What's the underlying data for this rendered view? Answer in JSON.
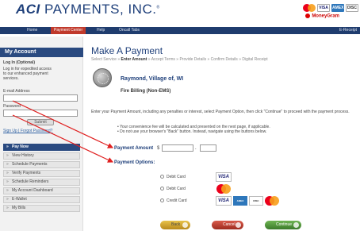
{
  "header": {
    "logo_bold": "ACI",
    "logo_rest": "PAYMENTS, INC.",
    "logo_tm": "®",
    "cards": [
      "VISA",
      "",
      "AMEX",
      "DISC"
    ],
    "moneygram": "MoneyGram"
  },
  "nav": {
    "items": [
      "Home",
      "Payment Center",
      "Help",
      "Oncall Tabs",
      "E-Receipt"
    ]
  },
  "sidebar": {
    "title": "My Account",
    "login_title": "Log In (Optional)",
    "login_text_1": "Log in for expedited access",
    "login_text_2": "to our enhanced payment",
    "login_text_3": "services.",
    "email_label": "E-mail Address",
    "password_label": "Password",
    "submit_label": "Submit",
    "links": "Sign Up | Forgot Password?",
    "menu_head": "Pay Now",
    "menu_items": [
      "View History",
      "Schedule Payments",
      "Verify Payments",
      "Schedule Reminders",
      "My Account Dashboard",
      "E-Wallet",
      "My Bills"
    ]
  },
  "main": {
    "title": "Make A Payment",
    "breadcrumb_prefix": "Select Service »",
    "breadcrumb_current": "Enter Amount",
    "breadcrumb_rest": "» Accept Terms » Provide Details » Confirm Details » Digital Receipt",
    "org_name": "Raymond, Village of, WI",
    "sub_name": "Fire Billing (Non-EMS)",
    "instructions": "Enter your Payment Amount, including any penalties or interest, select Payment Option, then click \"Continue\" to proceed with the payment process.",
    "bullet_1": "• Your convenience fee will be calculated and presented on the next page, if applicable.",
    "bullet_2": "• Do not use your browser's \"Back\" button. Instead, navigate using the buttons below.",
    "amount_label": "Payment Amount",
    "dollar": "$",
    "dot": ".",
    "options_label": "Payment Options:",
    "options": [
      "Debit Card",
      "Debit Card",
      "Credit Card"
    ]
  },
  "buttons": {
    "back": "Back",
    "cancel": "Cancel",
    "continue": "Continue"
  },
  "colors": {
    "brand": "#1e3f7a",
    "nav_active": "#c0392b",
    "arrow": "#e02020"
  }
}
